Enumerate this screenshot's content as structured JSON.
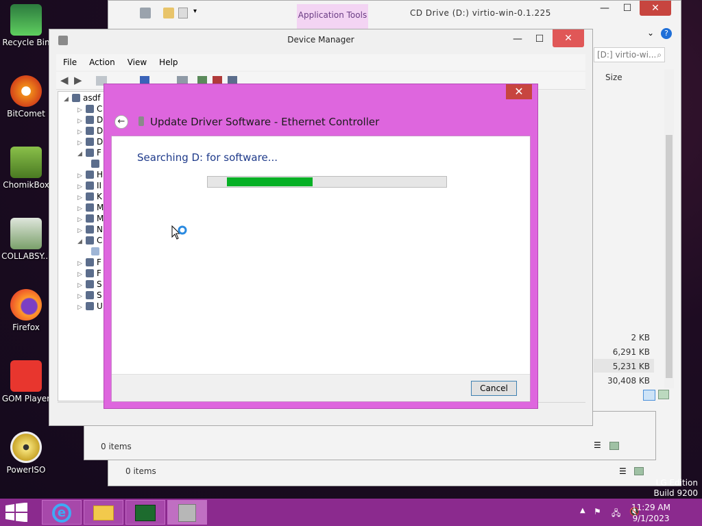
{
  "desktop": {
    "icons": [
      {
        "label": "Recycle Bin"
      },
      {
        "label": "BitComet"
      },
      {
        "label": "ChomikBox"
      },
      {
        "label": "COLLABSY..."
      },
      {
        "label": "Firefox"
      },
      {
        "label": "GOM Player"
      },
      {
        "label": "PowerISO"
      }
    ]
  },
  "explorer": {
    "ribbon_tab": "Application Tools",
    "title": "CD Drive (D:) virtio-win-0.1.225",
    "address": "[D:] virtio-wi...",
    "column_size": "Size",
    "sizes": [
      "2 KB",
      "6,291 KB",
      "5,231 KB",
      "30,408 KB"
    ],
    "status_items": "0 items"
  },
  "explorer_mid": {
    "status_items": "0 items"
  },
  "device_manager": {
    "title": "Device Manager",
    "menu": [
      "File",
      "Action",
      "View",
      "Help"
    ],
    "tree_root": "asdf",
    "tree_rows": [
      "C",
      "D",
      "D",
      "D",
      "F",
      "",
      "H",
      "II",
      "K",
      "M",
      "M",
      "N",
      "C",
      "",
      "F",
      "F",
      "S",
      "S",
      "U"
    ]
  },
  "dialog": {
    "title": "Update Driver Software - Ethernet Controller",
    "status": "Searching D: for software...",
    "progress": {
      "start_pct": 8,
      "end_pct": 44
    },
    "cancel_label": "Cancel",
    "close_glyph": "✕"
  },
  "taskbar": {
    "time": "11:29 AM",
    "date": "9/1/2023"
  },
  "watermark": {
    "line1": "LG Edition",
    "line2": "Build 9200"
  }
}
